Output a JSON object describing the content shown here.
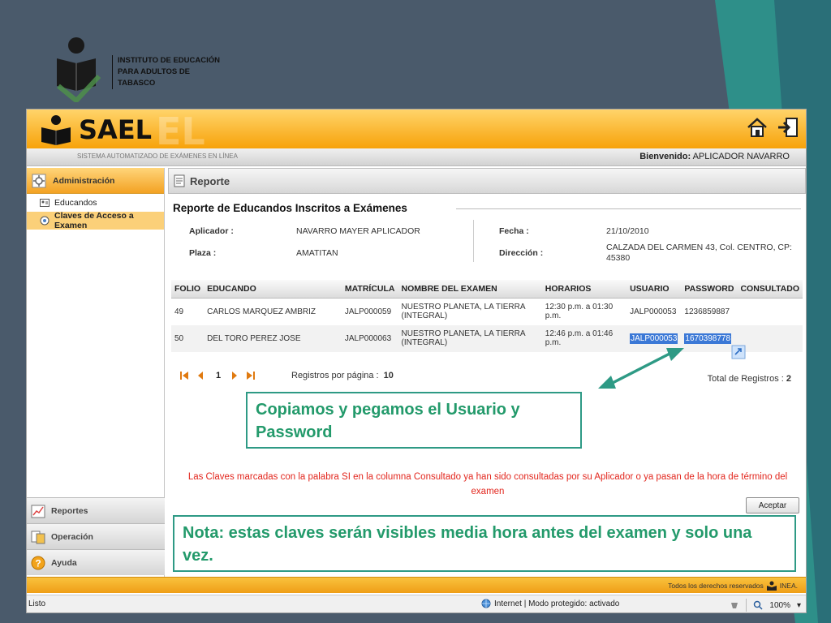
{
  "institution": {
    "name": "INSTITUTO DE EDUCACIÓN PARA ADULTOS DE TABASCO",
    "name_lines": [
      "INSTITUTO DE EDUCACIÓN",
      "PARA ADULTOS DE",
      "TABASCO"
    ]
  },
  "app": {
    "title": "SAEL",
    "subtitle": "SISTEMA AUTOMATIZADO DE EXÁMENES EN LÍNEA",
    "welcome_label": "Bienvenido:",
    "welcome_user": "APLICADOR NAVARRO",
    "icons": [
      "home-icon",
      "logout-icon"
    ]
  },
  "sidebar": {
    "header": "Administración",
    "items": [
      {
        "label": "Educandos",
        "icon": "id-card-icon"
      },
      {
        "label": "Claves de Acceso a Examen",
        "icon": "key-icon",
        "active": true
      }
    ],
    "bottom": [
      {
        "label": "Reportes",
        "icon": "chart-icon"
      },
      {
        "label": "Operación",
        "icon": "operation-icon"
      },
      {
        "label": "Ayuda",
        "icon": "help-icon"
      }
    ]
  },
  "panel": {
    "title": "Reporte",
    "report_title": "Reporte de Educandos Inscritos a Exámenes"
  },
  "info": {
    "aplicador_label": "Aplicador :",
    "aplicador_value": "NAVARRO MAYER APLICADOR",
    "plaza_label": "Plaza :",
    "plaza_value": "AMATITAN",
    "fecha_label": "Fecha :",
    "fecha_value": "21/10/2010",
    "direccion_label": "Dirección :",
    "direccion_value": "CALZADA DEL CARMEN 43, Col. CENTRO, CP: 45380"
  },
  "table": {
    "headers": [
      "FOLIO",
      "EDUCANDO",
      "MATRÍCULA",
      "NOMBRE DEL EXAMEN",
      "HORARIOS",
      "USUARIO",
      "PASSWORD",
      "CONSULTADO"
    ],
    "rows": [
      {
        "folio": "49",
        "educando": "CARLOS MARQUEZ AMBRIZ",
        "matricula": "JALP000059",
        "examen": "NUESTRO PLANETA, LA TIERRA (INTEGRAL)",
        "horario": "12:30 p.m. a 01:30 p.m.",
        "usuario": "JALP000053",
        "password": "1236859887",
        "consultado": ""
      },
      {
        "folio": "50",
        "educando": "DEL TORO PEREZ JOSE",
        "matricula": "JALP000063",
        "examen": "NUESTRO PLANETA, LA TIERRA (INTEGRAL)",
        "horario": "12:46 p.m. a 01:46 p.m.",
        "usuario": "JALP000053",
        "password": "1670398778",
        "consultado": ""
      }
    ]
  },
  "pager": {
    "page": "1",
    "per_page_label": "Registros por página :",
    "per_page_value": "10",
    "total_label": "Total de Registros :",
    "total_value": "2"
  },
  "callouts": {
    "copy_note": " Copiamos y pegamos el Usuario y Password",
    "visibility_note": "Nota: estas claves serán visibles media hora antes del examen y solo una vez."
  },
  "warning": "Las Claves marcadas con la palabra SI en la columna Consultado ya han sido consultadas por su Aplicador o ya pasan de la hora de término del examen",
  "buttons": {
    "accept": "Aceptar"
  },
  "footer": {
    "rights": "Todos los derechos reservados",
    "org": "INEA."
  },
  "browser_status": {
    "left": "Listo",
    "zone": "Internet | Modo protegido: activado",
    "zoom": "100%"
  },
  "colors": {
    "accent_orange": "#f7a20a",
    "callout_green": "#239a6b",
    "warning_red": "#e2261d",
    "selection_blue": "#3b78d6"
  }
}
